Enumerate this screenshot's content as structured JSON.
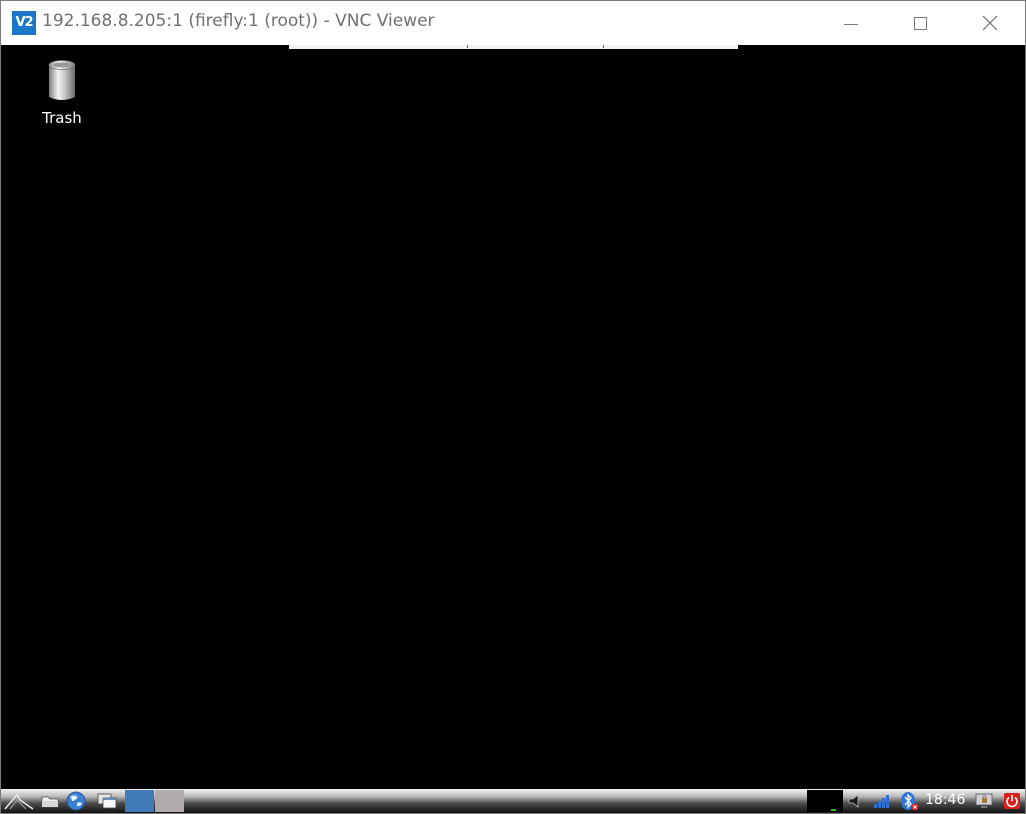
{
  "window": {
    "title": "192.168.8.205:1 (firefly:1 (root)) - VNC Viewer",
    "app_icon_text": "V2"
  },
  "desktop": {
    "icons": [
      {
        "label": "Trash",
        "icon": "trash-icon"
      }
    ]
  },
  "taskbar": {
    "launchers": [
      {
        "icon": "menu-icon"
      },
      {
        "icon": "file-manager-icon"
      },
      {
        "icon": "web-browser-icon"
      },
      {
        "icon": "window-switcher-icon"
      }
    ],
    "workspaces": [
      {
        "name": "workspace-1",
        "active": true,
        "color": "#3f7ab9"
      },
      {
        "name": "workspace-2",
        "active": false,
        "color": "#b0aaaa"
      }
    ],
    "tray": [
      "volume-icon",
      "network-signal-icon",
      "bluetooth-icon",
      "screen-lock-icon",
      "power-icon"
    ],
    "clock": "18:46"
  },
  "colors": {
    "accent": "#1b78c8",
    "desktop_bg": "#000000",
    "power": "#e02020"
  }
}
